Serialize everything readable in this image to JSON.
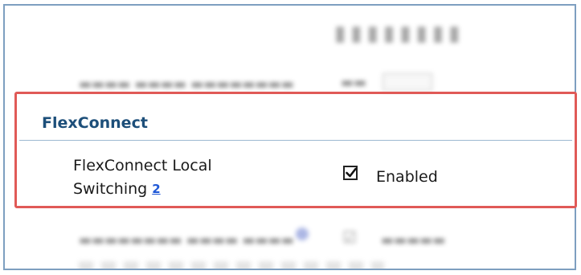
{
  "section": {
    "title": "FlexConnect"
  },
  "local_switching": {
    "label_line1": "FlexConnect Local",
    "label_line2": "Switching",
    "help_glyph": "2",
    "checked": true,
    "checkbox_label": "Enabled"
  },
  "colors": {
    "highlight_border": "#e05a57",
    "section_title": "#1d4f7a",
    "help_link": "#1f58d6",
    "frame_border": "#7e9fc0"
  }
}
